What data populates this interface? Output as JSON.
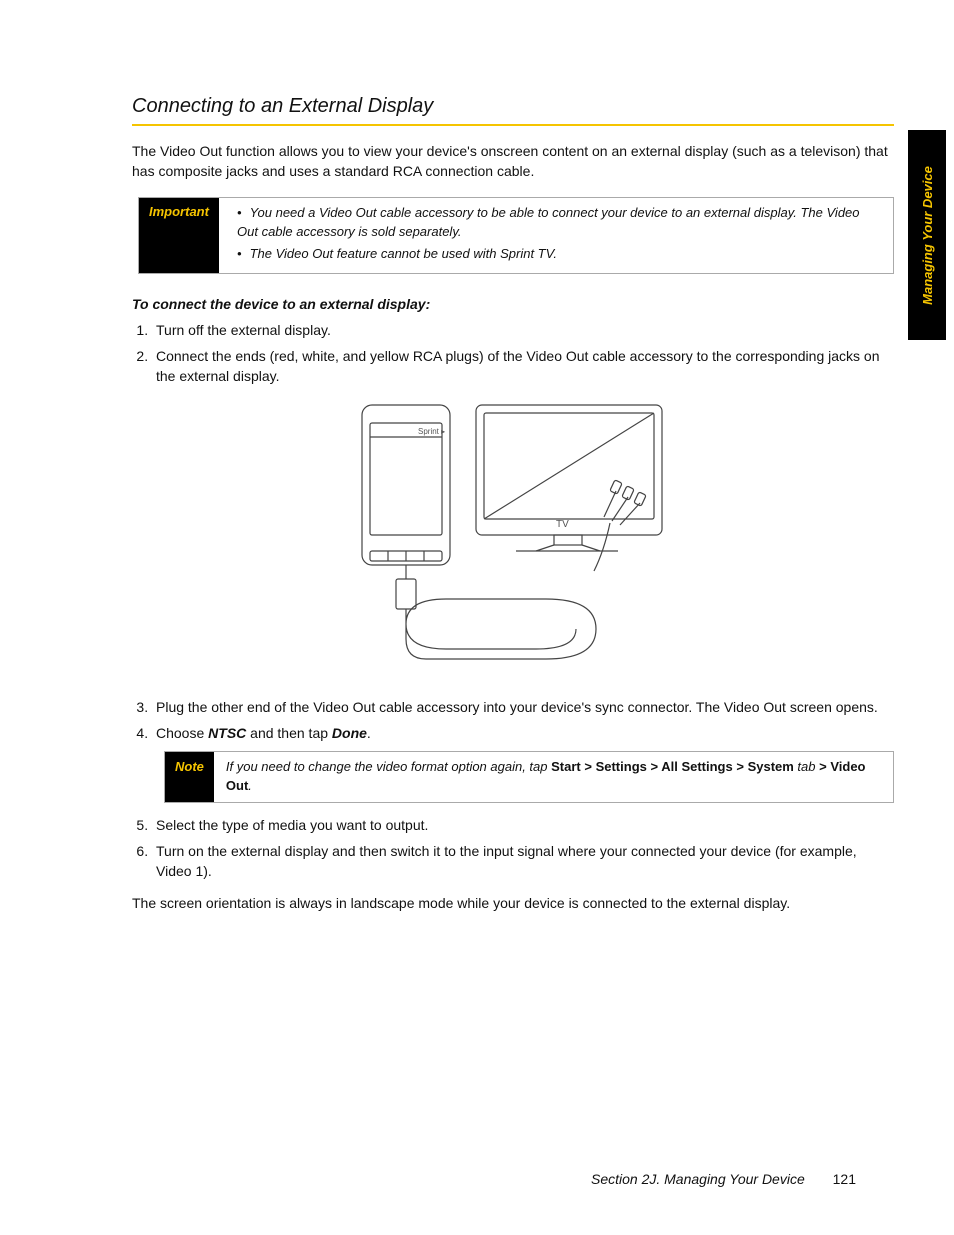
{
  "sideTab": "Managing Your Device",
  "title": "Connecting to an External Display",
  "intro": "The Video Out function allows you to view your device's onscreen content on an external display (such as a televison) that has composite jacks and uses a standard RCA connection cable.",
  "important": {
    "label": "Important",
    "bullets": [
      "You need a Video Out cable accessory to be able to connect your device to an external display. The Video Out cable accessory is sold separately.",
      "The Video Out feature cannot be used with Sprint TV."
    ]
  },
  "stepsHeading": "To connect the device to an external display:",
  "step1": "Turn off the external display.",
  "step2": "Connect the ends (red, white, and yellow RCA plugs) of the Video Out cable accessory to the corresponding jacks on the external display.",
  "figureTV": "TV",
  "figureSprint": "Sprint",
  "step3": "Plug the other end of the Video Out cable accessory into your device's sync connector. The Video Out screen opens.",
  "step4_a": "Choose ",
  "step4_b": "NTSC",
  "step4_c": " and then tap ",
  "step4_d": "Done",
  "step4_e": ".",
  "note": {
    "label": "Note",
    "prefix": "If you need to change the video format option again, tap ",
    "path1": "Start",
    "sep": " > ",
    "path2": "Settings",
    "path3": "All Settings",
    "path4": "System",
    "tabWord": " tab ",
    "path5": "Video Out",
    "suffix": "."
  },
  "step5": "Select the type of media you want to output.",
  "step6": "Turn on the external display and then switch it to the input signal where your connected your device (for example, Video 1).",
  "closing": "The screen orientation is always in landscape mode while your device is connected to the external display.",
  "footerText": "Section 2J. Managing Your Device",
  "pageNumber": "121"
}
